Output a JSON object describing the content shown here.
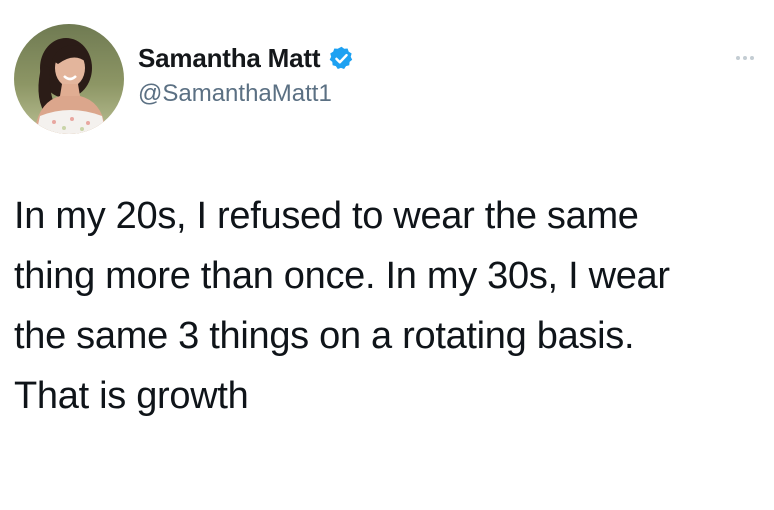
{
  "author": {
    "display_name": "Samantha Matt",
    "handle": "@SamanthaMatt1",
    "verified": true,
    "avatar_icon": "profile-photo"
  },
  "tweet": {
    "text": "In my 20s, I refused to wear the same\nthing more than once. In my 30s, I wear\nthe same 3 things on a rotating basis.\nThat is growth"
  },
  "menu_icon": "more-options-icon",
  "colors": {
    "verified_badge": "#1da1f2",
    "handle": "#5b7083",
    "text": "#0f1419",
    "background": "#ffffff"
  }
}
